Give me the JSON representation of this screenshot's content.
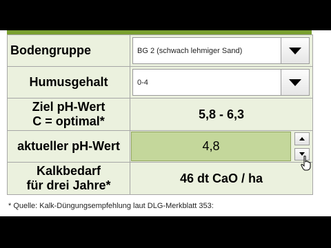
{
  "colors": {
    "cell_background": "#ebf1de",
    "input_background": "#c4d79b",
    "accent_bar": "#7aa030"
  },
  "rows": {
    "bodengruppe": {
      "label": "Bodengruppe",
      "value": "BG 2 (schwach lehmiger Sand)",
      "icon": "chevron-down-icon"
    },
    "humusgehalt": {
      "label": "Humusgehalt",
      "value": "0-4",
      "icon": "chevron-down-icon"
    },
    "ziel_ph": {
      "label_line1": "Ziel pH-Wert",
      "label_line2": "C = optimal*",
      "value": "5,8 - 6,3"
    },
    "aktueller_ph": {
      "label": "aktueller pH-Wert",
      "value": "4,8",
      "icons": [
        "arrow-up-icon",
        "arrow-down-icon"
      ]
    },
    "kalkbedarf": {
      "label_line1": "Kalkbedarf",
      "label_line2": "für drei Jahre*",
      "value": "46 dt CaO / ha"
    }
  },
  "footnote": "* Quelle: Kalk-Düngungsempfehlung laut DLG-Merkblatt 353:"
}
